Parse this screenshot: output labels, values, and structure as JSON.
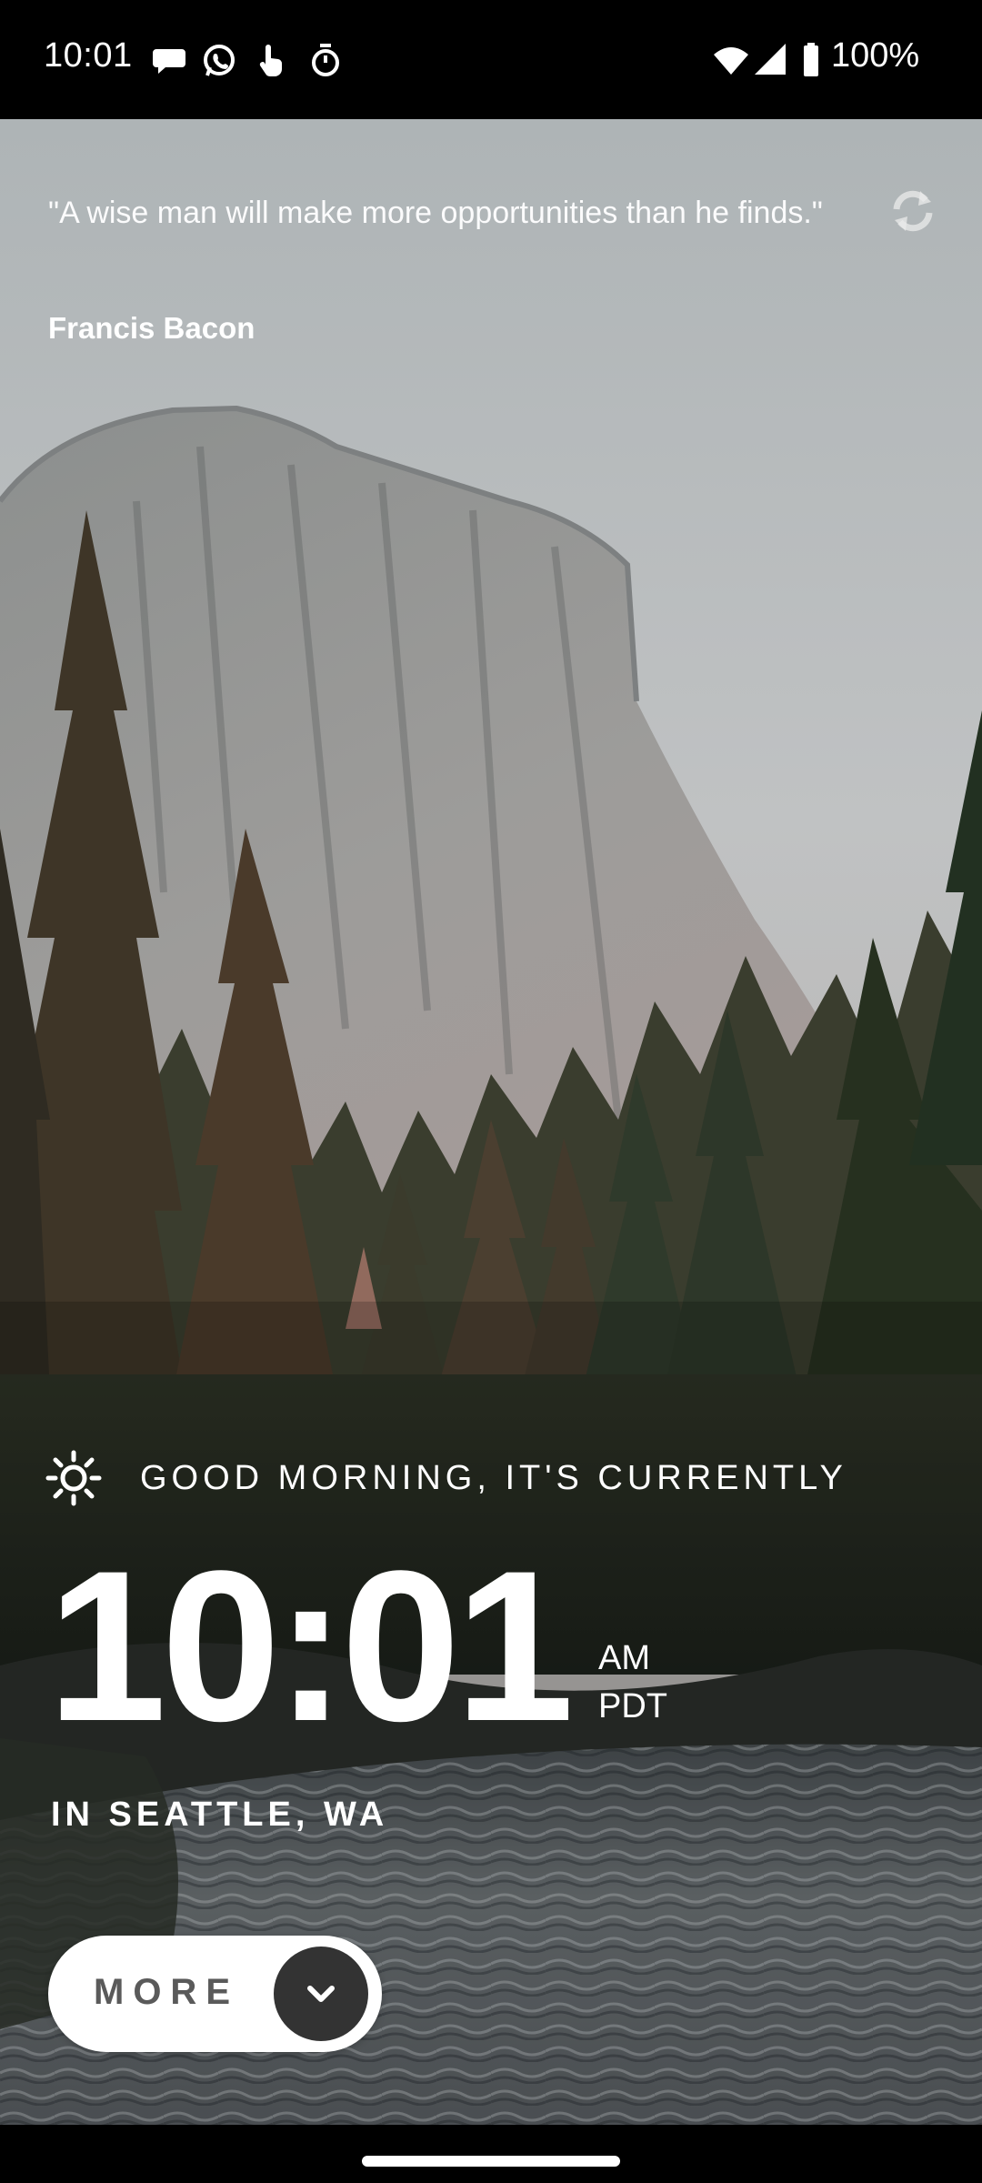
{
  "status_bar": {
    "time": "10:01",
    "notification_icons": [
      "chat-bubble-icon",
      "whatsapp-icon",
      "touch-hand-icon",
      "stopwatch-icon"
    ],
    "system_icons": [
      "wifi-icon",
      "cellular-signal-icon",
      "battery-icon"
    ],
    "battery_percent": "100%"
  },
  "quote": {
    "text": "\"A wise man will make more opportunities than he finds.\"",
    "author": "Francis Bacon",
    "refresh_icon": "refresh-icon"
  },
  "greeting": {
    "icon": "sun-icon",
    "text": "GOOD MORNING, IT'S CURRENTLY"
  },
  "clock": {
    "time": "10:01",
    "ampm": "AM",
    "timezone": "PDT"
  },
  "location": {
    "text": "IN SEATTLE, WA"
  },
  "more_button": {
    "label": "MORE",
    "icon": "chevron-down-icon"
  },
  "colors": {
    "text": "#ffffff",
    "button_background": "#ffffff",
    "button_label": "#5a5a5a",
    "chevron_circle": "#333333"
  }
}
